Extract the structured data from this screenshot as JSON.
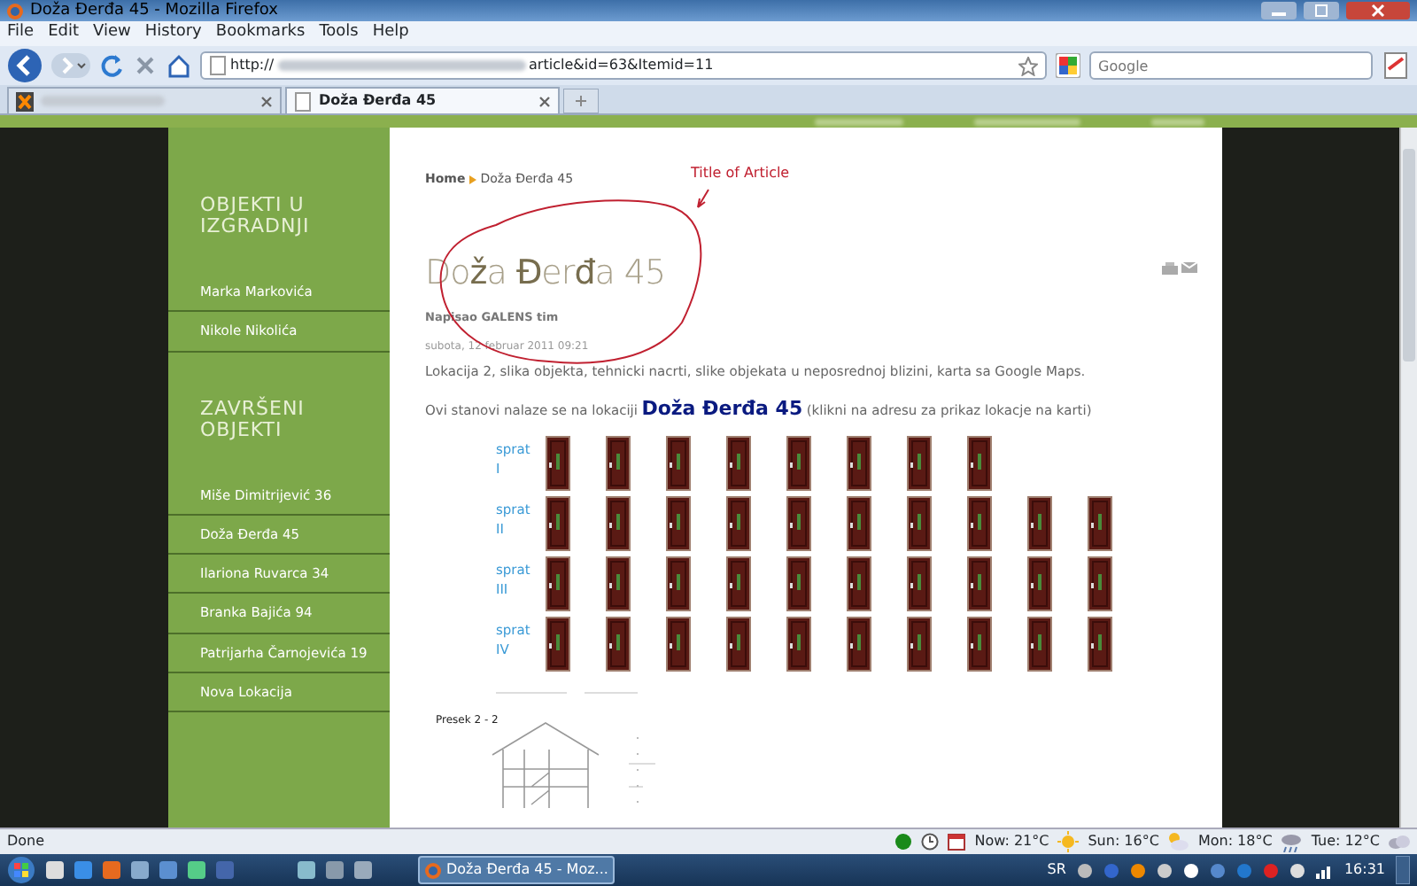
{
  "window": {
    "title": "Doža Đerđa 45 - Mozilla Firefox"
  },
  "menu": [
    "File",
    "Edit",
    "View",
    "History",
    "Bookmarks",
    "Tools",
    "Help"
  ],
  "address_bar": {
    "prefix": "http://",
    "suffix": "article&id=63&Itemid=11"
  },
  "search": {
    "placeholder": "Google"
  },
  "tabs": [
    {
      "selected": false,
      "blurred": true
    },
    {
      "label": "Doža Đerđa 45",
      "selected": true,
      "blurred": false
    }
  ],
  "sidebar": {
    "sections": [
      {
        "heading": "OBJEKTI U IZGRADNJI",
        "items": [
          "Marka Markovića",
          "Nikole Nikolića"
        ]
      },
      {
        "heading": "ZAVRŠENI OBJEKTI",
        "items": [
          "Miše Dimitrijević 36",
          "Doža Đerđa 45",
          "Ilariona Ruvarca 34",
          "Branka Bajića 94",
          "Patrijarha Čarnojevića 19",
          "Nova Lokacija"
        ]
      }
    ]
  },
  "breadcrumb": [
    "Home",
    "Doža Đerđa 45"
  ],
  "annotation": {
    "text": "Title of Article"
  },
  "article": {
    "title": "Do**ž**a **Đ**er**đ**a 45",
    "author": "Napisao GALENS tim",
    "date": "subota, 12 februar 2011 09:21",
    "intro": "Lokacija 2, slika objekta, tehnicki nacrti, slike objekata u neposrednoj blizini, karta sa Google Maps.",
    "location_before": "Ovi stanovi nalaze se na lokaciji",
    "location_link": "Doža Đerđa 45",
    "location_after": "(klikni na adresu za prikaz lokacje na karti)"
  },
  "floors": [
    {
      "label": "sprat",
      "numeral": "I",
      "doors": [
        {
          "kind": "door"
        },
        {
          "kind": "door"
        },
        {
          "kind": "door"
        },
        {
          "kind": "door"
        },
        {
          "kind": "door"
        },
        {
          "kind": "door"
        },
        {
          "kind": "door"
        },
        {
          "kind": "door"
        }
      ]
    },
    {
      "label": "sprat",
      "numeral": "II",
      "doors": [
        {
          "kind": "door"
        },
        {
          "kind": "door"
        },
        {
          "kind": "door"
        },
        {
          "kind": "door"
        },
        {
          "kind": "door"
        },
        {
          "kind": "door"
        },
        {
          "kind": "door"
        },
        {
          "kind": "door"
        },
        {
          "kind": "door"
        },
        {
          "kind": "door"
        }
      ]
    },
    {
      "label": "sprat",
      "numeral": "III",
      "doors": [
        {
          "kind": "door"
        },
        {
          "kind": "door"
        },
        {
          "kind": "door"
        },
        {
          "kind": "door"
        },
        {
          "kind": "door"
        },
        {
          "kind": "door"
        },
        {
          "kind": "door"
        },
        {
          "kind": "door"
        },
        {
          "kind": "door"
        },
        {
          "kind": "door"
        }
      ]
    },
    {
      "label": "sprat",
      "numeral": "IV",
      "doors": [
        {
          "kind": "door"
        },
        {
          "kind": "door"
        },
        {
          "kind": "door"
        },
        {
          "kind": "door"
        },
        {
          "kind": "door"
        },
        {
          "kind": "door"
        },
        {
          "kind": "door"
        },
        {
          "kind": "door"
        },
        {
          "kind": "door"
        },
        {
          "kind": "door"
        }
      ]
    }
  ],
  "section_drawing": {
    "label": "Presek 2 - 2"
  },
  "status_bar": {
    "text": "Done",
    "weather": [
      {
        "label": "Now: 21°C",
        "kind": "sun"
      },
      {
        "label": "Sun: 16°C",
        "kind": "cloud-sun"
      },
      {
        "label": "Mon: 18°C",
        "kind": "rain"
      },
      {
        "label": "Tue: 12°C",
        "kind": "cloud"
      }
    ]
  },
  "taskbar": {
    "window": "Doža Đerđa 45 - Moz...",
    "language": "SR",
    "time": "16:31"
  }
}
